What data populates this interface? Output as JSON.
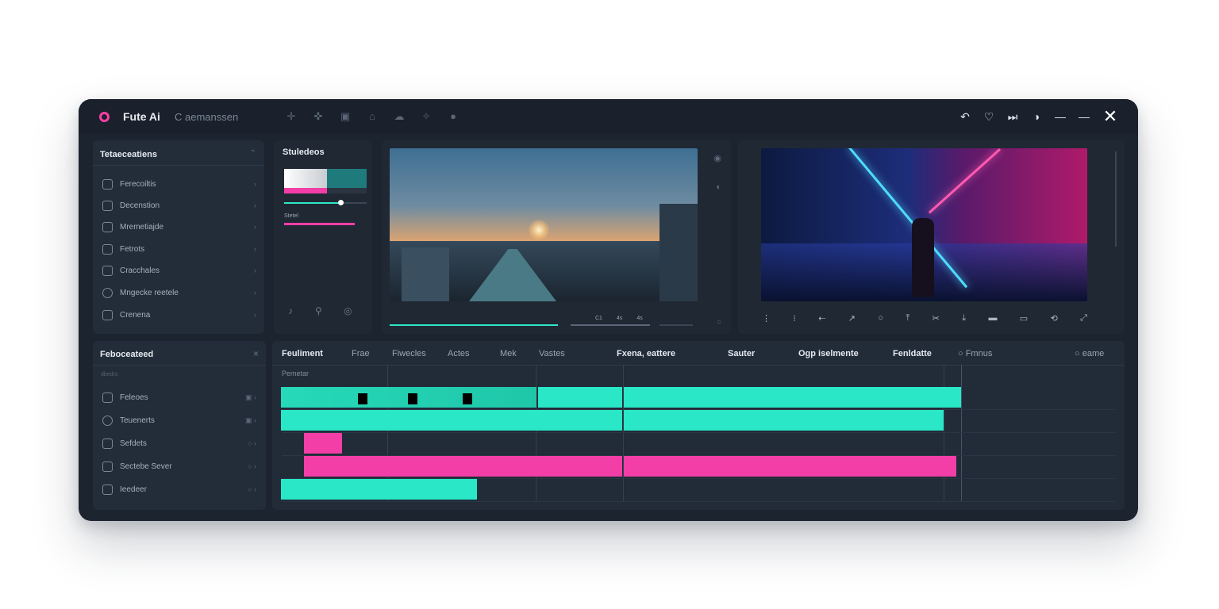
{
  "window": {
    "app_name": "Fute Ai",
    "subtitle": "C aemanssen",
    "toolbar_icons": [
      "move-icon",
      "crosshair-icon",
      "copy-icon",
      "group-icon",
      "cloud-icon",
      "sparkle-icon",
      "chat-icon"
    ],
    "controls": [
      "undo-icon",
      "heart-icon",
      "skip-icon",
      "globe-icon",
      "minimize-icon",
      "maximize-icon",
      "close-icon"
    ]
  },
  "left_panel": {
    "title": "Tetaeceatiens",
    "items": [
      {
        "label": "Ferecoiltis",
        "icon": "doc-icon"
      },
      {
        "label": "Decenstion",
        "icon": "doc-icon"
      },
      {
        "label": "Mremetiajde",
        "icon": "lock-icon"
      },
      {
        "label": "Fetrots",
        "icon": "doc-icon"
      },
      {
        "label": "Cracchales",
        "icon": "doc-icon"
      },
      {
        "label": "Mngecke reetele",
        "icon": "cloud-icon"
      },
      {
        "label": "Crenena",
        "icon": "doc-icon"
      }
    ]
  },
  "style_panel": {
    "title": "Stuledeos",
    "slider_label": "Stetel",
    "slider_value": 0.68
  },
  "preview_left": {
    "scrub_progress": 0.55
  },
  "preview_right": {
    "transport_times": [
      "C1",
      "4s",
      "4s"
    ]
  },
  "bottom_left": {
    "title": "Feboceateed",
    "subtitle": "dbedrs",
    "items": [
      {
        "label": "Feleoes"
      },
      {
        "label": "Teuenerts"
      },
      {
        "label": "Sefdets"
      },
      {
        "label": "Sectebe Sever"
      },
      {
        "label": "Ieedeer"
      }
    ]
  },
  "timeline": {
    "columns": [
      "Feuliment",
      "Frae",
      "Fiwecles",
      "Actes",
      "Mek",
      "Vastes",
      "Fxena, eattere",
      "Sauter",
      "Ogp iselmente",
      "Fenldatte",
      "Fmnus",
      "eame"
    ],
    "row_label": "Pemetar",
    "accent_teal": "#29e7c7",
    "accent_pink": "#f23ea6"
  }
}
